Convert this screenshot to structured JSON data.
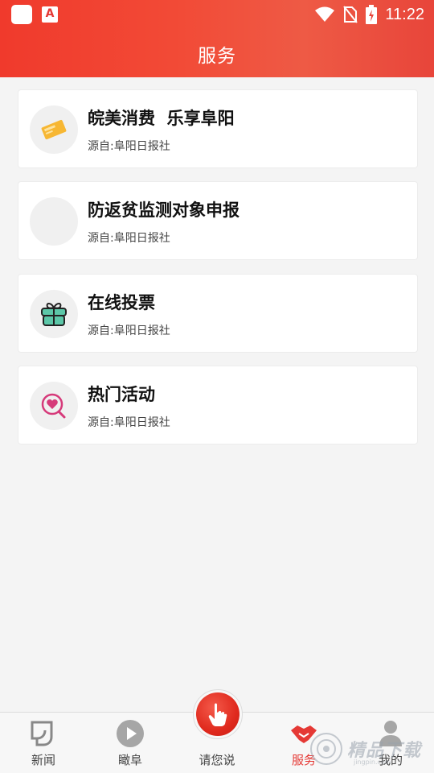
{
  "status_bar": {
    "time": "11:22",
    "icons": [
      "app-square-icon",
      "pdf-app-icon",
      "wifi-icon",
      "no-sim-icon",
      "battery-charging-icon"
    ],
    "app_icon_letter": "A"
  },
  "header": {
    "title": "服务",
    "accent_color": "#f03a2c"
  },
  "services": [
    {
      "title": "皖美消费  乐享阜阳",
      "source": "源自:阜阳日报社",
      "icon": "coupon-icon"
    },
    {
      "title": "防返贫监测对象申报",
      "source": "源自:阜阳日报社",
      "icon": "blank-icon"
    },
    {
      "title": "在线投票",
      "source": "源自:阜阳日报社",
      "icon": "gift-icon"
    },
    {
      "title": "热门活动",
      "source": "源自:阜阳日报社",
      "icon": "heart-search-icon"
    }
  ],
  "tabbar": {
    "tabs": [
      {
        "label": "新闻",
        "icon": "news-icon"
      },
      {
        "label": "瞰阜",
        "icon": "play-icon"
      },
      {
        "label": "请您说",
        "icon": "touch-icon"
      },
      {
        "label": "服务",
        "icon": "handshake-icon",
        "active": true
      },
      {
        "label": "我的",
        "icon": "profile-icon"
      }
    ],
    "active_color": "#e53935"
  },
  "watermark": {
    "text": "精品下载",
    "url": "jingpin.com"
  }
}
